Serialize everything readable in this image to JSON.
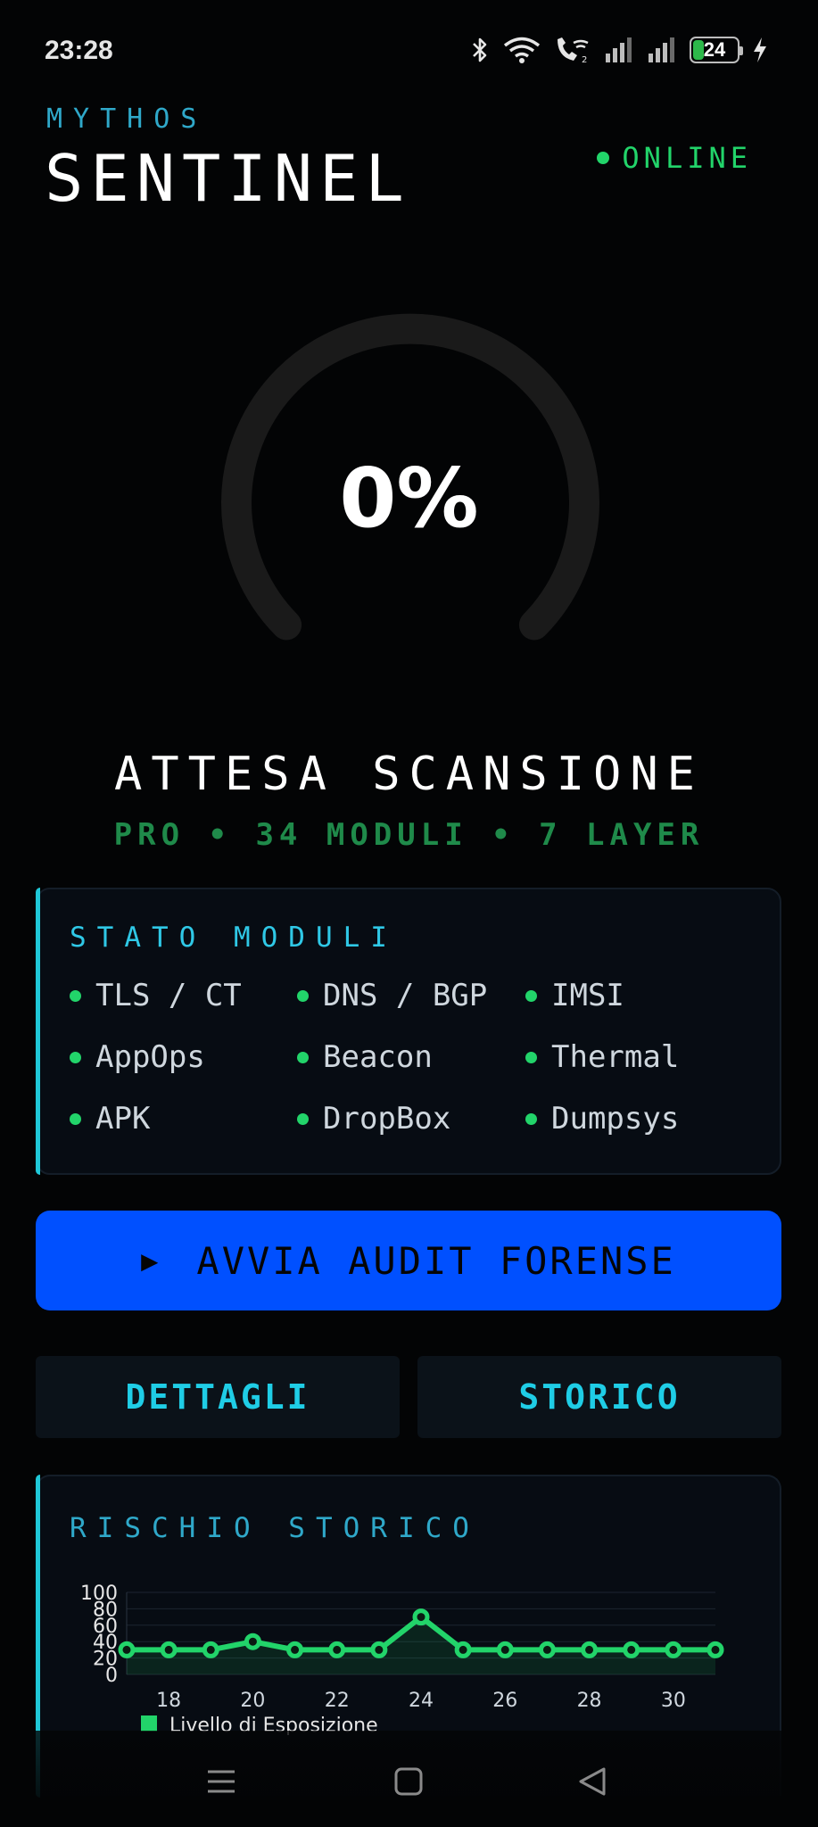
{
  "status_bar": {
    "time": "23:28",
    "battery": "24",
    "battery_level": 0.24
  },
  "header": {
    "brand_top": "MYTHOS",
    "brand_main": "SENTINEL",
    "status": "ONLINE",
    "status_color": "#22d46a"
  },
  "gauge": {
    "value_text": "0%",
    "value": 0,
    "track_color": "#1a1a1a"
  },
  "scan": {
    "status": "ATTESA SCANSIONE",
    "subtitle": "PRO • 34 MODULI • 7 LAYER"
  },
  "modules_panel": {
    "title": "STATO MODULI",
    "items": [
      {
        "label": "TLS / CT"
      },
      {
        "label": "DNS / BGP"
      },
      {
        "label": "IMSI"
      },
      {
        "label": "AppOps"
      },
      {
        "label": "Beacon"
      },
      {
        "label": "Thermal"
      },
      {
        "label": "APK"
      },
      {
        "label": "DropBox"
      },
      {
        "label": "Dumpsys"
      }
    ]
  },
  "actions": {
    "audit_icon": "▶",
    "audit_label": "AVVIA AUDIT FORENSE",
    "details_label": "DETTAGLI",
    "history_label": "STORICO"
  },
  "risk_panel": {
    "title": "RISCHIO STORICO"
  },
  "chart_data": {
    "type": "line",
    "x": [
      17,
      18,
      19,
      20,
      21,
      22,
      23,
      24,
      25,
      26,
      27,
      28,
      29,
      30,
      31
    ],
    "x_tick_labels": [
      "18",
      "20",
      "22",
      "24",
      "26",
      "28",
      "30"
    ],
    "x_ticks": [
      18,
      20,
      22,
      24,
      26,
      28,
      30
    ],
    "y_tick_labels": [
      "100",
      "80",
      "60",
      "40",
      "20",
      "0"
    ],
    "y_ticks": [
      100,
      80,
      60,
      40,
      20,
      0
    ],
    "ylim": [
      0,
      100
    ],
    "series": [
      {
        "name": "Livello di Esposizione",
        "values": [
          30,
          30,
          30,
          40,
          30,
          30,
          30,
          70,
          30,
          30,
          30,
          30,
          30,
          30,
          30
        ],
        "color": "#22d46a"
      }
    ],
    "legend": "bottom-left",
    "grid": true
  }
}
